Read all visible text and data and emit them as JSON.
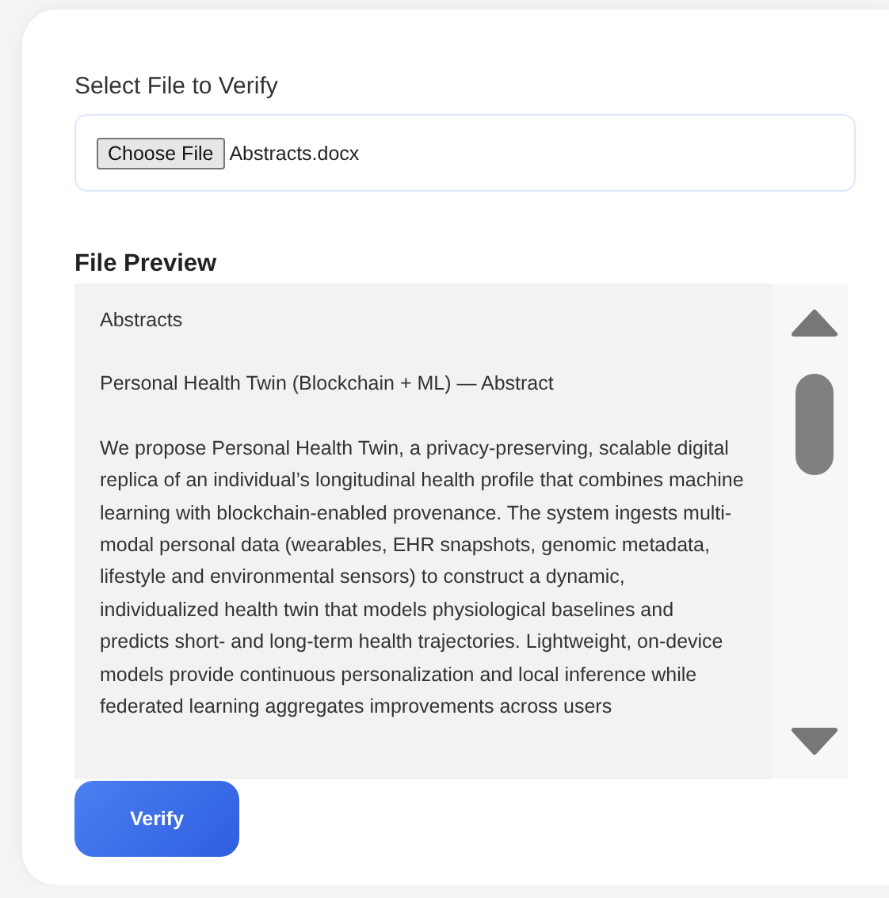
{
  "file_field": {
    "label": "Select File to Verify",
    "button": "Choose File",
    "value": "Abstracts.docx"
  },
  "preview": {
    "title": "File Preview",
    "paragraphs": [
      "Abstracts",
      "Personal Health Twin (Blockchain + ML) — Abstract",
      "We propose Personal Health Twin, a privacy-preserving, scalable digital replica of an individual’s longitudinal health profile that combines machine learning with blockchain-enabled provenance. The system ingests multi-modal personal data (wearables, EHR snapshots, genomic metadata, lifestyle and environmental sensors) to construct a dynamic, individualized health twin that models physiological baselines and predicts short- and long-term health trajectories. Lightweight, on-device models provide continuous personalization and local inference while federated learning aggregates improvements across users"
    ]
  },
  "actions": {
    "verify": "Verify"
  }
}
